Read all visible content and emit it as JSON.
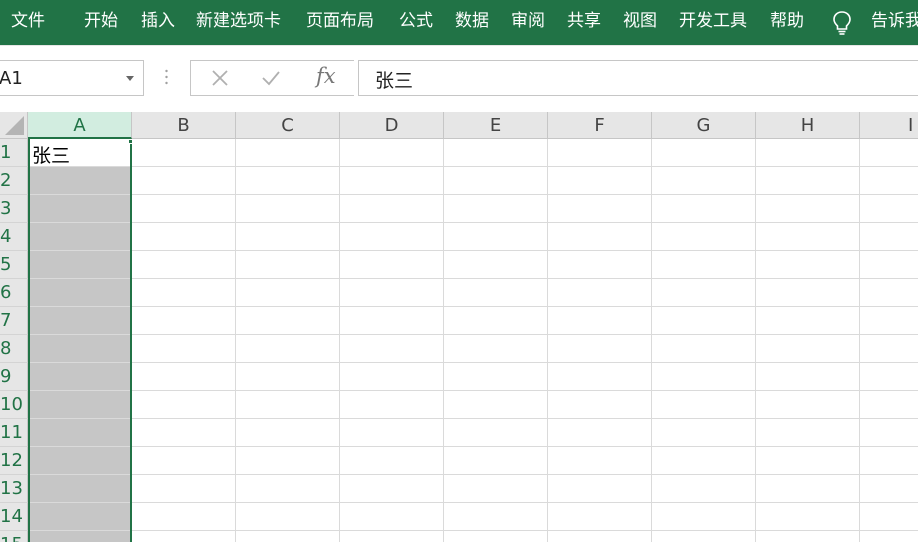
{
  "ribbon": {
    "tabs": [
      "文件",
      "开始",
      "插入",
      "新建选项卡",
      "页面布局",
      "公式",
      "数据",
      "审阅",
      "共享",
      "视图",
      "开发工具",
      "帮助"
    ],
    "tell_me_icon": "lightbulb-icon",
    "tell_me_label": "告诉我",
    "background_color": "#217346"
  },
  "formula_bar": {
    "name_box_value": "A1",
    "cancel_icon": "close-icon",
    "enter_icon": "check-icon",
    "fx_label": "fx",
    "formula_value": "张三"
  },
  "sheet": {
    "columns": [
      "A",
      "B",
      "C",
      "D",
      "E",
      "F",
      "G",
      "H",
      "I"
    ],
    "rows": [
      "1",
      "2",
      "3",
      "4",
      "5",
      "6",
      "7",
      "8",
      "9",
      "10",
      "11",
      "12",
      "13",
      "14",
      "15"
    ],
    "selected_column": "A",
    "active_cell": "A1",
    "cells": {
      "A1": "张三"
    },
    "accent_color": "#217346",
    "selection_fill_color": "#c6c6c6"
  }
}
